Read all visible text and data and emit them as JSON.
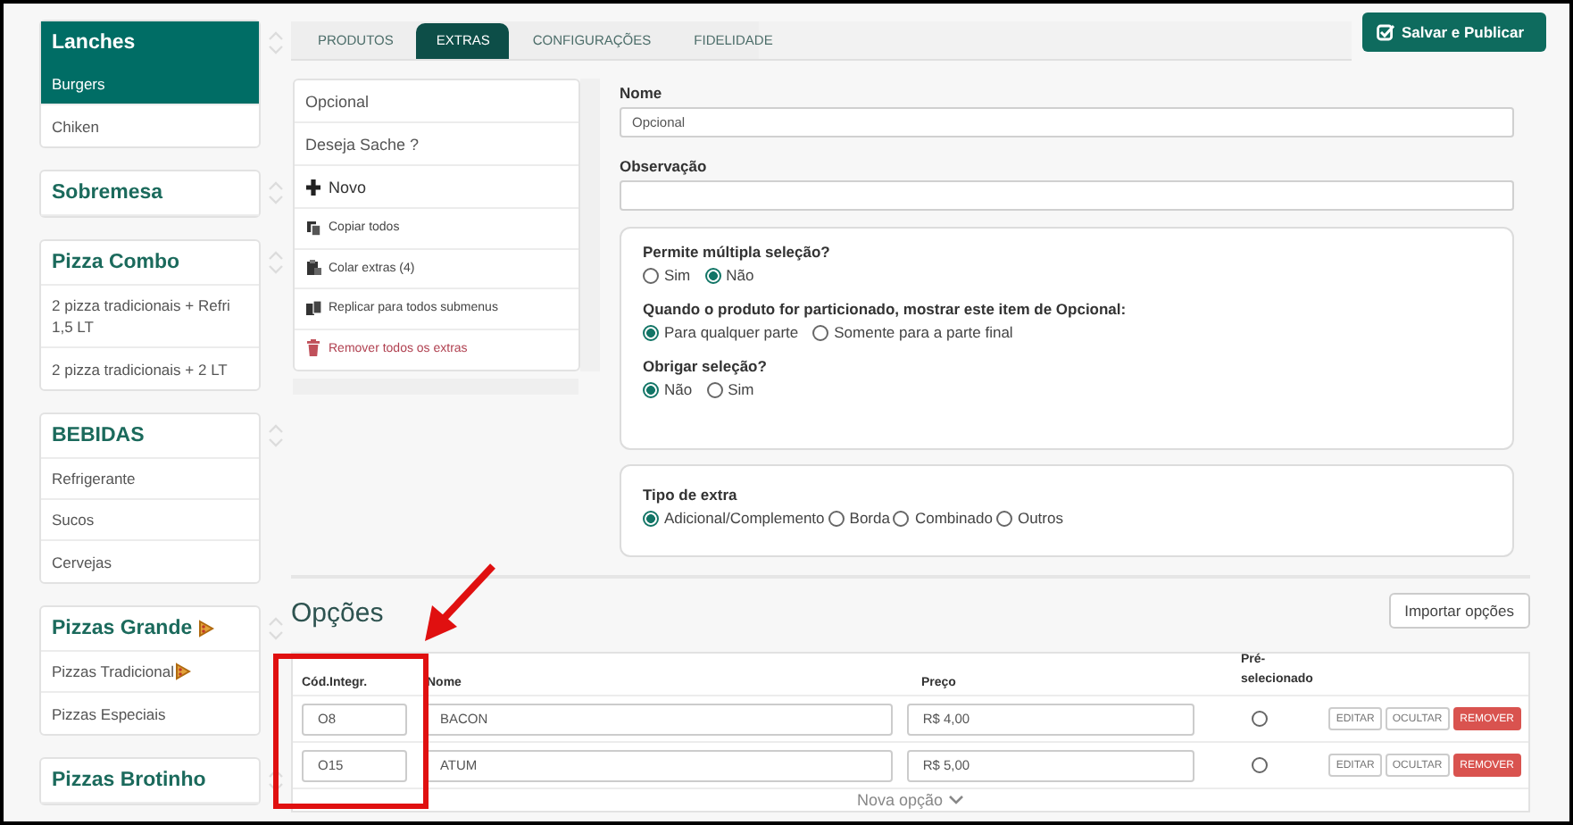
{
  "sidebar": {
    "groups": [
      {
        "title": "Lanches",
        "selected": true,
        "has_icon": false,
        "items": [
          {
            "label": "Burgers",
            "selected": true,
            "has_icon": false
          },
          {
            "label": "Chiken",
            "selected": false,
            "has_icon": false
          }
        ]
      },
      {
        "title": "Sobremesa",
        "selected": false,
        "has_icon": false
      },
      {
        "title": "Pizza Combo",
        "selected": false,
        "has_icon": false,
        "items": [
          {
            "label": "2 pizza tradicionais + Refri 1,5 LT",
            "selected": false,
            "has_icon": false
          },
          {
            "label": "2 pizza tradicionais + 2 LT",
            "selected": false,
            "has_icon": false
          }
        ]
      },
      {
        "title": "BEBIDAS",
        "selected": false,
        "has_icon": false,
        "items": [
          {
            "label": "Refrigerante",
            "selected": false,
            "has_icon": false
          },
          {
            "label": "Sucos",
            "selected": false,
            "has_icon": false
          },
          {
            "label": "Cervejas",
            "selected": false,
            "has_icon": false
          }
        ]
      },
      {
        "title": "Pizzas Grande",
        "selected": false,
        "has_icon": true,
        "items": [
          {
            "label": "Pizzas Tradicional",
            "selected": false,
            "has_icon": true
          },
          {
            "label": "Pizzas Especiais",
            "selected": false,
            "has_icon": false
          }
        ]
      },
      {
        "title": "Pizzas Brotinho",
        "selected": false,
        "has_icon": false
      }
    ]
  },
  "tabs": [
    {
      "label": "PRODUTOS",
      "selected": false
    },
    {
      "label": "EXTRAS",
      "selected": true
    },
    {
      "label": "CONFIGURAÇÕES",
      "selected": false
    },
    {
      "label": "FIDELIDADE",
      "selected": false
    }
  ],
  "save_button": "Salvar e Publicar",
  "extras_list": [
    {
      "kind": "extra",
      "label": "Opcional"
    },
    {
      "kind": "extra",
      "label": "Deseja Sache ?"
    },
    {
      "kind": "add",
      "label": "Novo"
    },
    {
      "kind": "copy",
      "label": "Copiar todos"
    },
    {
      "kind": "paste",
      "label": "Colar extras (4)"
    },
    {
      "kind": "replicate",
      "label": "Replicar para todos submenus"
    },
    {
      "kind": "remove",
      "label": "Remover todos os extras"
    }
  ],
  "form": {
    "name_label": "Nome",
    "name_value": "Opcional",
    "note_label": "Observação",
    "questions": [
      {
        "label": "Permite múltipla seleção?",
        "options": [
          {
            "label": "Sim",
            "selected": false
          },
          {
            "label": "Não",
            "selected": true
          }
        ]
      },
      {
        "label": "Quando o produto for particionado, mostrar este item de Opcional:",
        "options": [
          {
            "label": "Para qualquer parte",
            "selected": true
          },
          {
            "label": "Somente para a parte final",
            "selected": false
          }
        ]
      },
      {
        "label": "Obrigar seleção?",
        "options": [
          {
            "label": "Não",
            "selected": true
          },
          {
            "label": "Sim",
            "selected": false
          }
        ]
      }
    ],
    "extra_type": {
      "label": "Tipo de extra",
      "options": [
        {
          "label": "Adicional/Complemento",
          "selected": true
        },
        {
          "label": "Borda",
          "selected": false
        },
        {
          "label": "Combinado",
          "selected": false
        },
        {
          "label": "Outros",
          "selected": false
        }
      ]
    }
  },
  "options": {
    "title": "Opções",
    "import_button": "Importar opções",
    "columns": [
      "Cód.Integr.",
      "Nome",
      "Preço",
      "Pré-selecionado"
    ],
    "rows": [
      {
        "code": "O8",
        "name": "BACON",
        "price": "R$ 4,00",
        "preselected": false,
        "actions": [
          "EDITAR",
          "OCULTAR",
          "REMOVER"
        ]
      },
      {
        "code": "O15",
        "name": "ATUM",
        "price": "R$ 5,00",
        "preselected": false,
        "actions": [
          "EDITAR",
          "OCULTAR",
          "REMOVER"
        ]
      }
    ],
    "new_option": "Nova opção"
  }
}
